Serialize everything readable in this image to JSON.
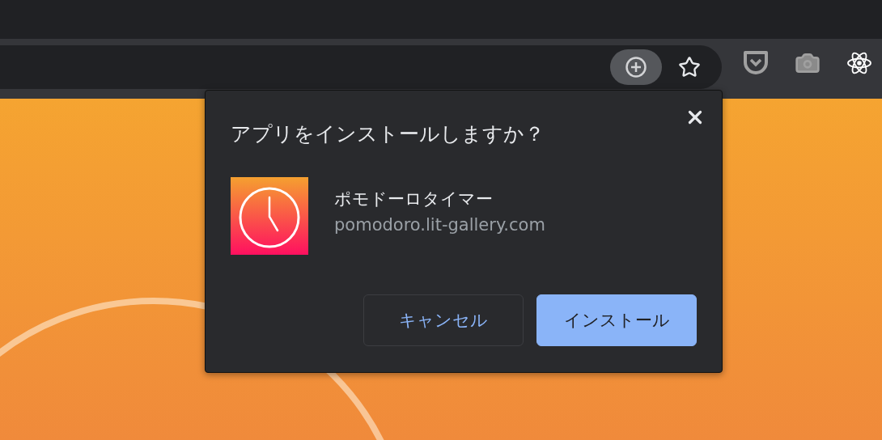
{
  "dialog": {
    "title": "アプリをインストールしますか？",
    "app": {
      "name": "ポモドーロタイマー",
      "url": "pomodoro.lit-gallery.com"
    },
    "buttons": [
      {
        "label": "キャンセル",
        "kind": "secondary"
      },
      {
        "label": "インストール",
        "kind": "primary"
      }
    ]
  }
}
